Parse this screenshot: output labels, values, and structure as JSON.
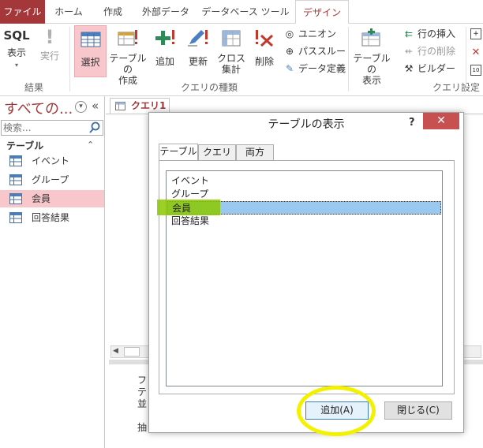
{
  "ribbon_tabs": [
    {
      "label": "ファイル"
    },
    {
      "label": "ホーム"
    },
    {
      "label": "作成"
    },
    {
      "label": "外部データ"
    },
    {
      "label": "データベース ツール"
    },
    {
      "label": "デザイン"
    }
  ],
  "ribbon": {
    "results": {
      "view_icon_text": "SQL",
      "view_label": "表示",
      "run_label": "実行",
      "group_label": "結果"
    },
    "query_type": {
      "select_label": "選択",
      "make_table_label_1": "テーブルの",
      "make_table_label_2": "作成",
      "append_label": "追加",
      "update_label": "更新",
      "crosstab_label_1": "クロス",
      "crosstab_label_2": "集計",
      "delete_label": "削除",
      "union_label": "ユニオン",
      "passthrough_label": "パススルー",
      "data_definition_label": "データ定義",
      "group_label": "クエリの種類"
    },
    "query_setup": {
      "show_table_label_1": "テーブルの",
      "show_table_label_2": "表示",
      "insert_rows_label": "行の挿入",
      "delete_rows_label": "行の削除",
      "builder_label": "ビルダー",
      "group_label": "クエリ設定"
    }
  },
  "nav_pane": {
    "title": "すべての...",
    "search_placeholder": "検索...",
    "group_label": "テーブル",
    "items": [
      {
        "label": "イベント"
      },
      {
        "label": "グループ"
      },
      {
        "label": "会員"
      },
      {
        "label": "回答結果"
      }
    ],
    "selected_item": "会員"
  },
  "document": {
    "tab_label": "クエリ1",
    "grid_row_labels": [
      "フ",
      "テ",
      "並",
      "",
      "抽"
    ]
  },
  "dialog": {
    "title": "テーブルの表示",
    "help_label": "?",
    "close_label": "✕",
    "tabs": [
      {
        "label": "テーブル"
      },
      {
        "label": "クエリ"
      },
      {
        "label": "両方"
      }
    ],
    "active_tab": "テーブル",
    "list_items": [
      {
        "label": "イベント"
      },
      {
        "label": "グループ"
      },
      {
        "label": "会員"
      },
      {
        "label": "回答結果"
      }
    ],
    "selected_item": "会員",
    "add_button_label": "追加(A)",
    "close_button_label": "閉じる(C)"
  },
  "colors": {
    "accent": "#a4373a",
    "selection_pink": "#f7c7cc",
    "list_selection": "#99c9ef",
    "annotation_yellow": "#f2f200",
    "annotation_green": "#8cc800",
    "dialog_close": "#c75050"
  }
}
